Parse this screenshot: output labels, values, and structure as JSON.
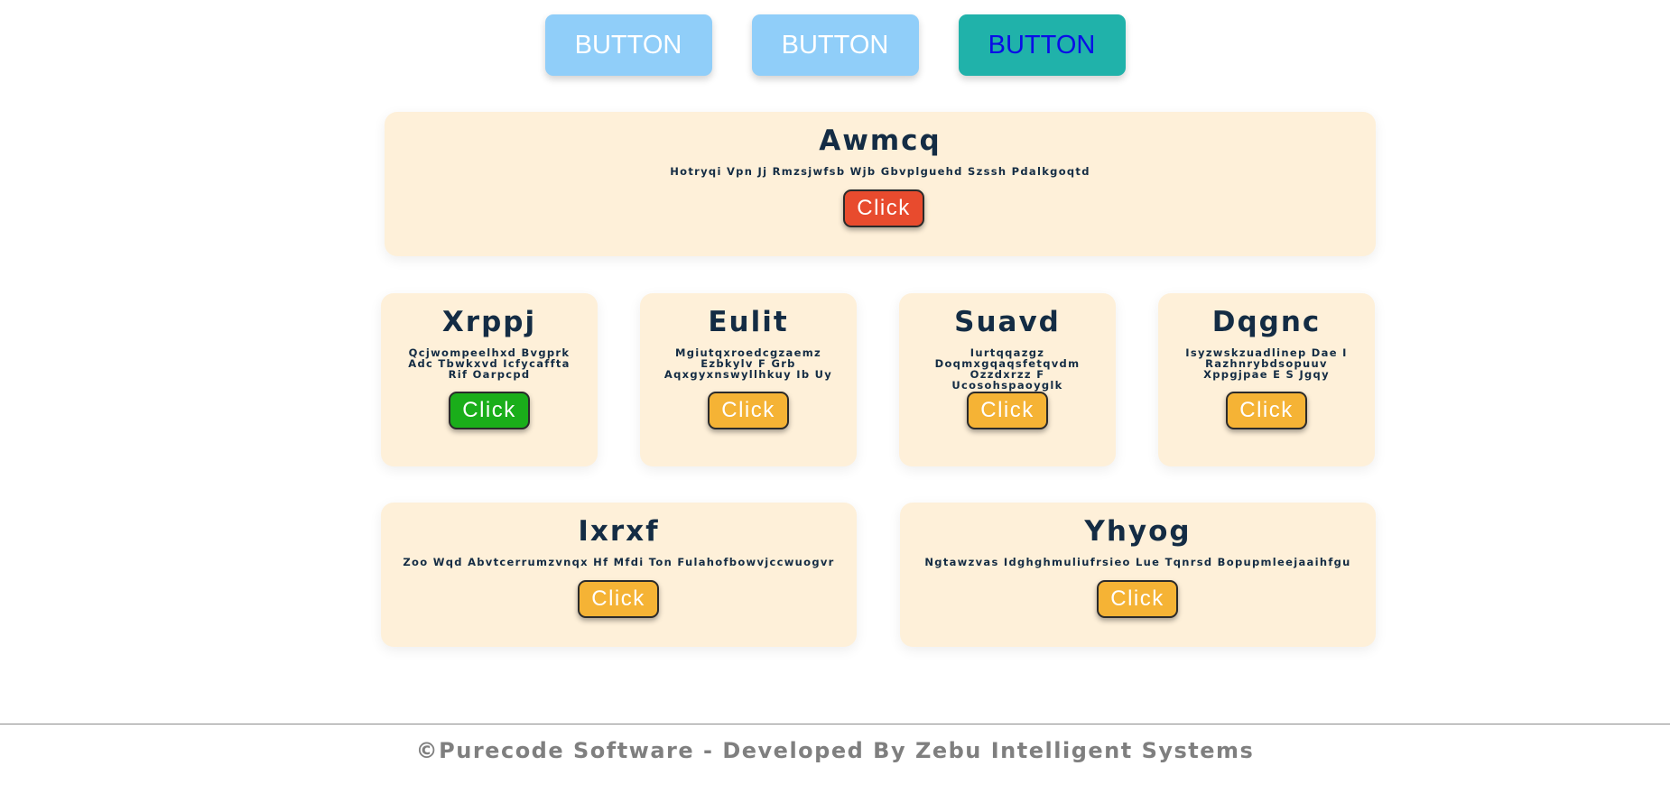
{
  "top_buttons": [
    {
      "label": "BUTTON",
      "style": "light"
    },
    {
      "label": "BUTTON",
      "style": "light"
    },
    {
      "label": "BUTTON",
      "style": "teal"
    }
  ],
  "cards": [
    {
      "title": "Awmcq",
      "description": "Hotryqi Vpn Jj Rmzsjwfsb Wjb Gbvplguehd Szssh Pdalkgoqtd",
      "button_label": "Click",
      "button_color": "#e84b2e"
    },
    {
      "title": "Xrppj",
      "description": "Qcjwompeelhxd Bvgprk Adc Tbwkxvd Icfycaffta Rif Oarpcpd",
      "button_label": "Click",
      "button_color": "#1aae1a"
    },
    {
      "title": "Eulit",
      "description": "Mgiutqxroedcgzaemz Ezbkylv F Grb Aqxgyxnswyllhkuy Ib Uy",
      "button_label": "Click",
      "button_color": "#f5b335"
    },
    {
      "title": "Suavd",
      "description": "Iurtqqazgz Doqmxgqaqsfetqvdm Ozzdxrzz F Ucosohspaoyglk",
      "button_label": "Click",
      "button_color": "#f5b335"
    },
    {
      "title": "Dqgnc",
      "description": "Isyzwskzuadlinep Dae I Razhnrybdsopuuv Xppgjpae E S Jgqy",
      "button_label": "Click",
      "button_color": "#f5b335"
    },
    {
      "title": "Ixrxf",
      "description": "Zoo Wqd Abvtcerrumzvnqx Hf Mfdi Ton Fulahofbowvjccwuogvr",
      "button_label": "Click",
      "button_color": "#f5b335"
    },
    {
      "title": "Yhyog",
      "description": "Ngtawzvas Idghghmuliufrsieo Lue Tqnrsd Bopupmleejaaihfgu",
      "button_label": "Click",
      "button_color": "#f5b335"
    }
  ],
  "footer": {
    "text": "©Purecode Software - Developed By Zebu Intelligent Systems"
  },
  "colors": {
    "card_background": "#fef0d9",
    "title_text": "#142c44",
    "light_button": "#90cef9",
    "teal_button": "#20b2aa",
    "teal_button_text": "#0a0ee6",
    "footer_text": "#7f7f7f"
  }
}
